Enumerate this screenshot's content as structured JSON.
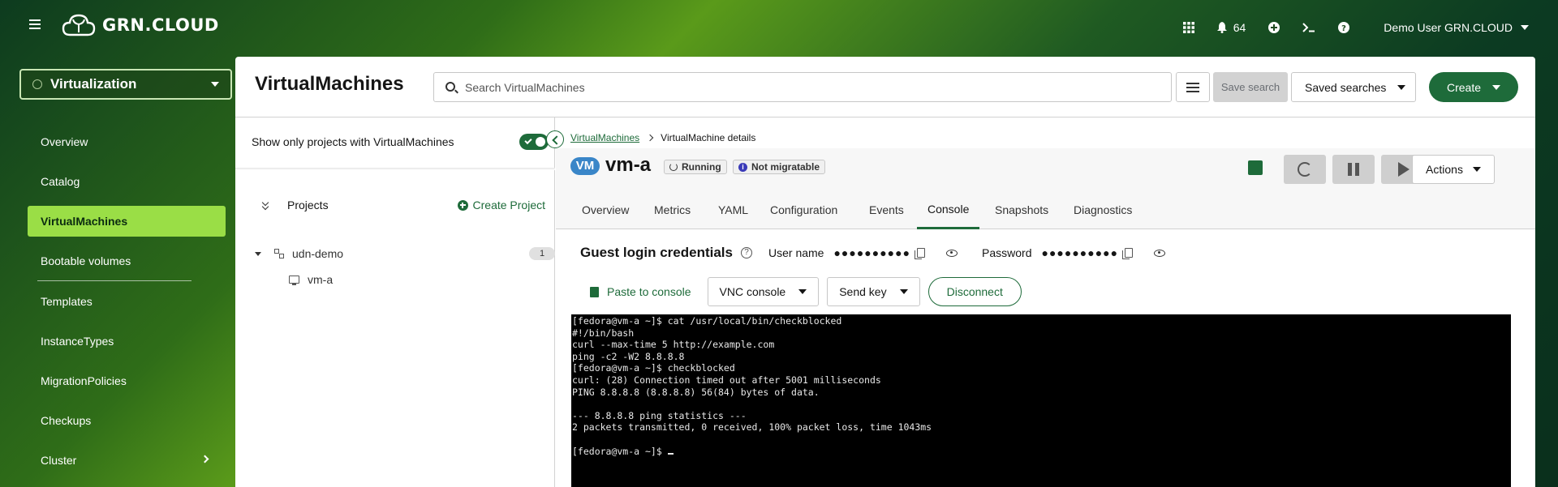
{
  "topbar": {
    "logo_text": "GRN.CLOUD",
    "notifications_count": "64",
    "user_label": "Demo User GRN.CLOUD"
  },
  "sidebar": {
    "perspective": "Virtualization",
    "items": [
      {
        "label": "Overview"
      },
      {
        "label": "Catalog"
      },
      {
        "label": "VirtualMachines",
        "active": true
      },
      {
        "label": "Bootable volumes"
      },
      {
        "label": "Templates"
      },
      {
        "label": "InstanceTypes"
      },
      {
        "label": "MigrationPolicies"
      },
      {
        "label": "Checkups"
      },
      {
        "label": "Cluster"
      }
    ]
  },
  "header": {
    "title": "VirtualMachines",
    "search_placeholder": "Search VirtualMachines",
    "save_search": "Save search",
    "saved_searches": "Saved searches",
    "create": "Create"
  },
  "projects_panel": {
    "toggle_label": "Show only projects with VirtualMachines",
    "projects_label": "Projects",
    "create_project": "Create Project",
    "tree": {
      "namespace": "udn-demo",
      "count": "1",
      "vm": "vm-a"
    }
  },
  "details": {
    "breadcrumb_link": "VirtualMachines",
    "breadcrumb_current": "VirtualMachine details",
    "vm_badge": "VM",
    "vm_name": "vm-a",
    "status_running": "Running",
    "status_migratable": "Not migratable",
    "actions": "Actions",
    "tabs": [
      "Overview",
      "Metrics",
      "YAML",
      "Configuration",
      "Events",
      "Console",
      "Snapshots",
      "Diagnostics"
    ],
    "active_tab": "Console",
    "credentials": {
      "title": "Guest login credentials",
      "username_label": "User name",
      "username_mask": "●●●●●●●●●●",
      "password_label": "Password",
      "password_mask": "●●●●●●●●●●"
    },
    "console_toolbar": {
      "paste": "Paste to console",
      "vnc": "VNC console",
      "send_key": "Send key",
      "disconnect": "Disconnect"
    },
    "terminal_lines": [
      "[fedora@vm-a ~]$ cat /usr/local/bin/checkblocked",
      "#!/bin/bash",
      "curl --max-time 5 http://example.com",
      "ping -c2 -W2 8.8.8.8",
      "[fedora@vm-a ~]$ checkblocked",
      "curl: (28) Connection timed out after 5001 milliseconds",
      "PING 8.8.8.8 (8.8.8.8) 56(84) bytes of data.",
      "",
      "--- 8.8.8.8 ping statistics ---",
      "2 packets transmitted, 0 received, 100% packet loss, time 1043ms",
      "",
      "[fedora@vm-a ~]$ "
    ]
  },
  "colors": {
    "accent": "#1e6b3a",
    "active_nav": "#9ade46",
    "vm_badge": "#3a86c8"
  }
}
